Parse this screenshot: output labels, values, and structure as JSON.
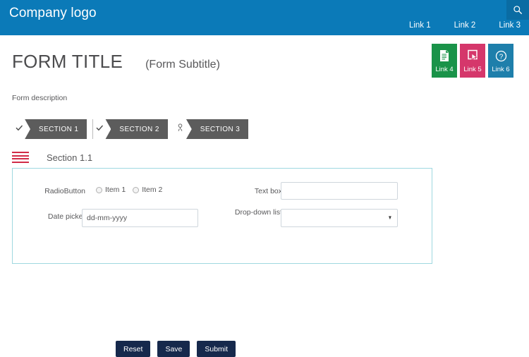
{
  "header": {
    "company_logo": "Company logo",
    "search_icon": "search-icon",
    "nav_links": [
      {
        "label": "Link 1"
      },
      {
        "label": "Link 2"
      },
      {
        "label": "Link 3"
      }
    ],
    "background_color": "#0b7ab8",
    "search_box_color": "#0a6ca3"
  },
  "page": {
    "title": "FORM TITLE",
    "subtitle": "(Form Subtitle)",
    "description": "Form description"
  },
  "link_tiles": [
    {
      "label": "Link 4",
      "icon": "document-icon",
      "color": "#1a9349"
    },
    {
      "label": "Link 5",
      "icon": "click-cursor-icon",
      "color": "#d5376b"
    },
    {
      "label": "Link 6",
      "icon": "question-mark-icon",
      "color": "#1e7fab"
    }
  ],
  "section_tabs": [
    {
      "label": "SECTION 1",
      "icon": "check-icon"
    },
    {
      "label": "SECTION 2",
      "icon": "check-icon"
    },
    {
      "label": "SECTION 3",
      "icon": "person-icon"
    }
  ],
  "subsection": {
    "menu_icon": "hamburger-menu-icon",
    "title": "Section 1.1"
  },
  "form": {
    "radio": {
      "label": "RadioButton",
      "options": [
        {
          "label": "Item 1",
          "selected": false
        },
        {
          "label": "Item 2",
          "selected": false
        }
      ]
    },
    "date_picker": {
      "label": "Date picker",
      "value": "",
      "placeholder": "dd-mm-yyyy"
    },
    "text_box": {
      "label": "Text box",
      "value": "",
      "placeholder": ""
    },
    "dropdown": {
      "label": "Drop-down list",
      "selected": "",
      "arrow_icon": "chevron-down-icon"
    },
    "panel_border_color": "#9fd8e0"
  },
  "footer": {
    "buttons": [
      {
        "label": "Reset"
      },
      {
        "label": "Save"
      },
      {
        "label": "Submit"
      }
    ],
    "button_color": "#16294c"
  }
}
